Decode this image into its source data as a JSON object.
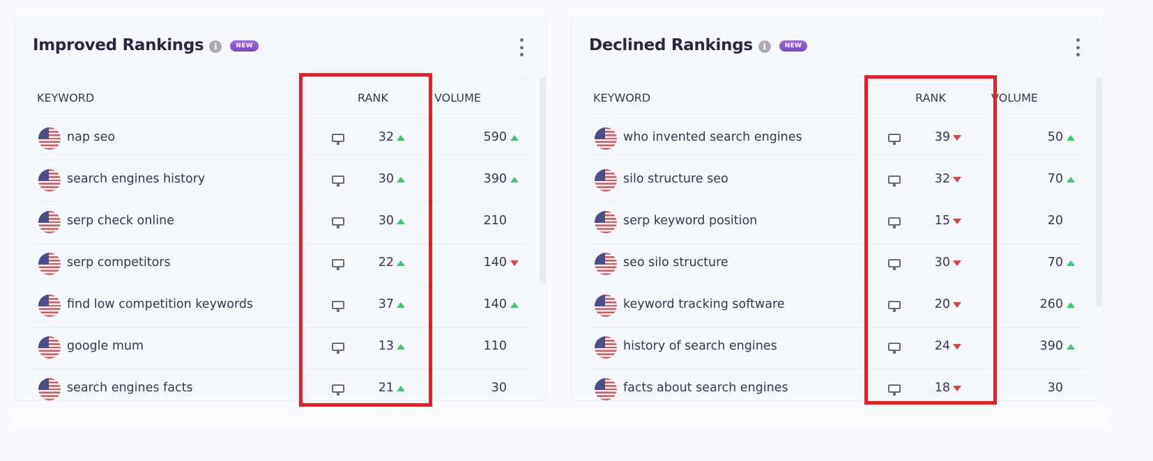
{
  "colors": {
    "up": "#3dc96a",
    "down": "#dc4444",
    "highlight": "#ee1c25",
    "badge": "#8b55cc"
  },
  "panels": [
    {
      "title": "Improved Rankings",
      "info_icon": "info-icon",
      "badge": "NEW",
      "menu_icon": "kebab-menu-icon",
      "columns": {
        "keyword": "KEYWORD",
        "device": "",
        "rank": "RANK",
        "volume": "VOLUME"
      },
      "rows": [
        {
          "flag": "us-flag-icon",
          "keyword": "nap seo",
          "device": "desktop-icon",
          "rank": "32",
          "rank_trend": "up",
          "volume": "590",
          "volume_trend": "up"
        },
        {
          "flag": "us-flag-icon",
          "keyword": "search engines history",
          "device": "desktop-icon",
          "rank": "30",
          "rank_trend": "up",
          "volume": "390",
          "volume_trend": "up"
        },
        {
          "flag": "us-flag-icon",
          "keyword": "serp check online",
          "device": "desktop-icon",
          "rank": "30",
          "rank_trend": "up",
          "volume": "210",
          "volume_trend": "none"
        },
        {
          "flag": "us-flag-icon",
          "keyword": "serp competitors",
          "device": "desktop-icon",
          "rank": "22",
          "rank_trend": "up",
          "volume": "140",
          "volume_trend": "down"
        },
        {
          "flag": "us-flag-icon",
          "keyword": "find low competition keywords",
          "device": "desktop-icon",
          "rank": "37",
          "rank_trend": "up",
          "volume": "140",
          "volume_trend": "up"
        },
        {
          "flag": "us-flag-icon",
          "keyword": "google mum",
          "device": "desktop-icon",
          "rank": "13",
          "rank_trend": "up",
          "volume": "110",
          "volume_trend": "none"
        },
        {
          "flag": "us-flag-icon",
          "keyword": "search engines facts",
          "device": "desktop-icon",
          "rank": "21",
          "rank_trend": "up",
          "volume": "30",
          "volume_trend": "none"
        }
      ]
    },
    {
      "title": "Declined Rankings",
      "info_icon": "info-icon",
      "badge": "NEW",
      "menu_icon": "kebab-menu-icon",
      "columns": {
        "keyword": "KEYWORD",
        "device": "",
        "rank": "RANK",
        "volume": "VOLUME"
      },
      "rows": [
        {
          "flag": "us-flag-icon",
          "keyword": "who invented search engines",
          "device": "desktop-icon",
          "rank": "39",
          "rank_trend": "down",
          "volume": "50",
          "volume_trend": "up"
        },
        {
          "flag": "us-flag-icon",
          "keyword": "silo structure seo",
          "device": "desktop-icon",
          "rank": "32",
          "rank_trend": "down",
          "volume": "70",
          "volume_trend": "up"
        },
        {
          "flag": "us-flag-icon",
          "keyword": "serp keyword position",
          "device": "desktop-icon",
          "rank": "15",
          "rank_trend": "down",
          "volume": "20",
          "volume_trend": "none"
        },
        {
          "flag": "us-flag-icon",
          "keyword": "seo silo structure",
          "device": "desktop-icon",
          "rank": "30",
          "rank_trend": "down",
          "volume": "70",
          "volume_trend": "up"
        },
        {
          "flag": "us-flag-icon",
          "keyword": "keyword tracking software",
          "device": "desktop-icon",
          "rank": "20",
          "rank_trend": "down",
          "volume": "260",
          "volume_trend": "up"
        },
        {
          "flag": "us-flag-icon",
          "keyword": "history of search engines",
          "device": "desktop-icon",
          "rank": "24",
          "rank_trend": "down",
          "volume": "390",
          "volume_trend": "up"
        },
        {
          "flag": "us-flag-icon",
          "keyword": "facts about search engines",
          "device": "desktop-icon",
          "rank": "18",
          "rank_trend": "down",
          "volume": "30",
          "volume_trend": "none"
        }
      ]
    }
  ],
  "annotations": [
    {
      "type": "highlight-box",
      "target": "Improved Rankings rank column"
    },
    {
      "type": "highlight-box",
      "target": "Declined Rankings rank column"
    }
  ]
}
